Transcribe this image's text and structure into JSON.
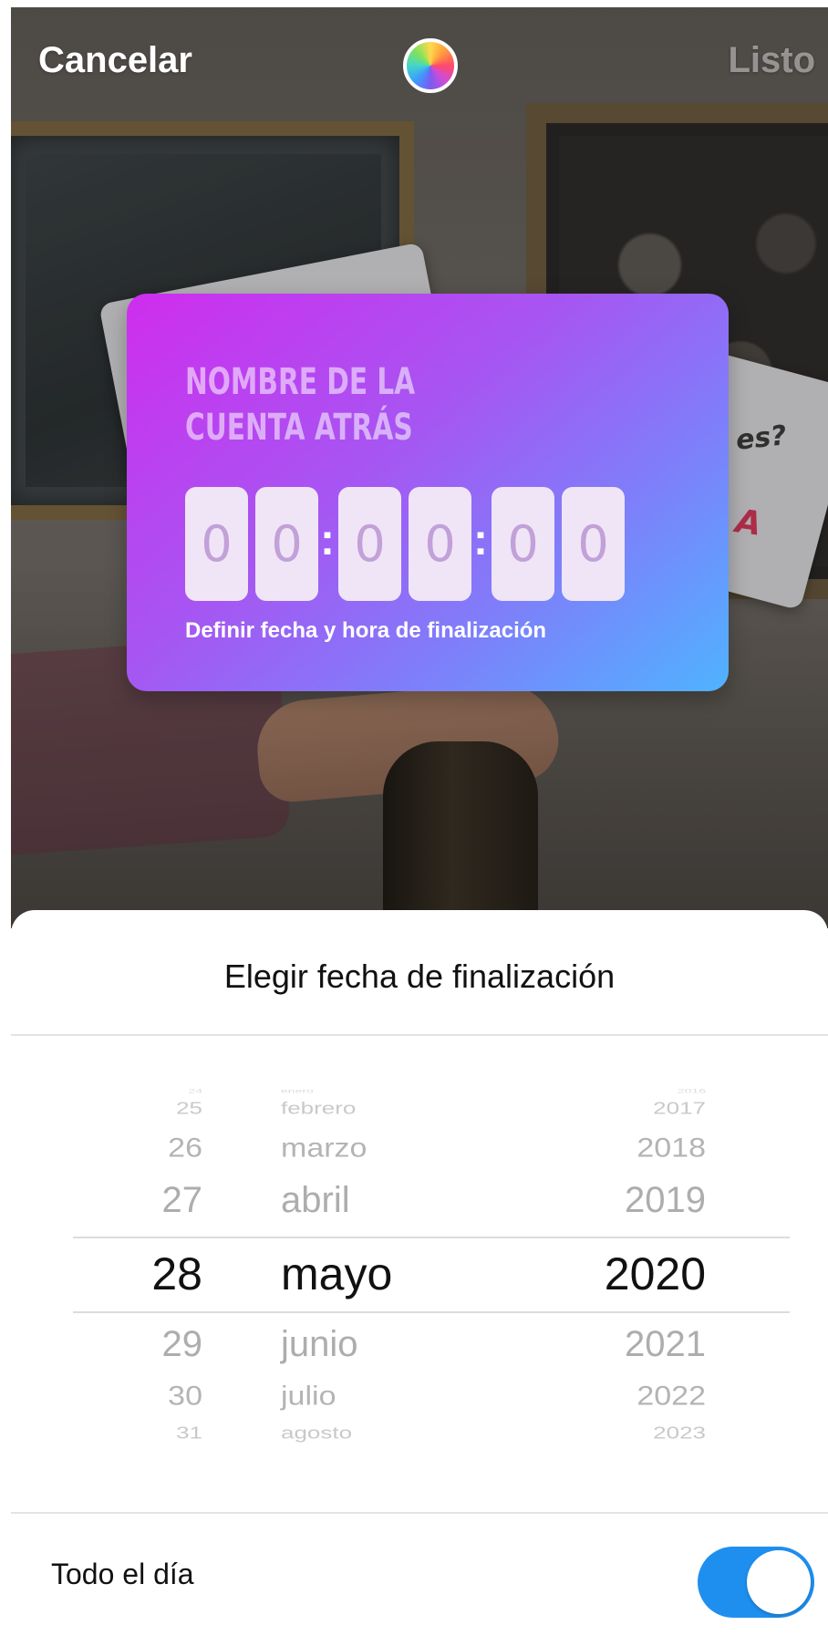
{
  "top_bar": {
    "cancel_label": "Cancelar",
    "done_label": "Listo",
    "color_picker_icon": "color-wheel-icon"
  },
  "background_text": {
    "fragment_1": "es?",
    "fragment_2": "A"
  },
  "sticker": {
    "title": "NOMBRE DE LA CUENTA ATRÁS",
    "digits": [
      "0",
      "0",
      "0",
      "0",
      "0",
      "0"
    ],
    "separator": ":",
    "hint": "Definir fecha y hora de finalización",
    "gradient_colors": [
      "#cf2dee",
      "#a656f2",
      "#4fb3ff"
    ]
  },
  "sheet": {
    "title": "Elegir fecha de finalización",
    "picker": {
      "days": [
        "24",
        "25",
        "26",
        "27",
        "28",
        "29",
        "30",
        "31"
      ],
      "months": [
        "enero",
        "febrero",
        "marzo",
        "abril",
        "mayo",
        "junio",
        "julio",
        "agosto"
      ],
      "years": [
        "2016",
        "2017",
        "2018",
        "2019",
        "2020",
        "2021",
        "2022",
        "2023"
      ],
      "selected_day": "28",
      "selected_month": "mayo",
      "selected_year": "2020"
    },
    "all_day": {
      "label": "Todo el día",
      "enabled": true,
      "accent_color": "#1f8fef"
    }
  }
}
